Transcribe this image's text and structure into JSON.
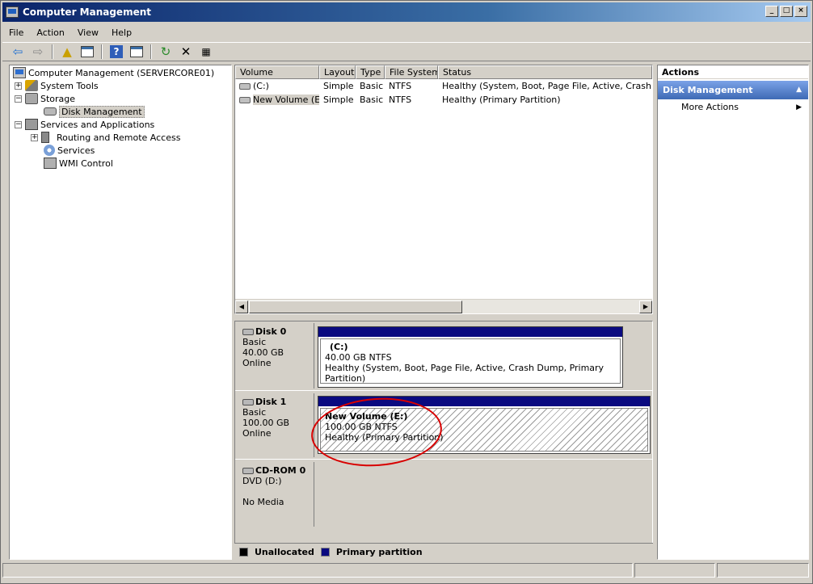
{
  "window": {
    "title": "Computer Management"
  },
  "menu": [
    "File",
    "Action",
    "View",
    "Help"
  ],
  "toolbar": {
    "icons": [
      "back-arrow-icon",
      "forward-arrow-icon",
      "up-folder-icon",
      "show-hide-tree-icon",
      "help-icon",
      "properties-icon",
      "refresh-icon",
      "delete-icon",
      "export-icon"
    ]
  },
  "tree": {
    "root": "Computer Management (SERVERCORE01)",
    "system_tools": "System Tools",
    "storage": "Storage",
    "disk_management": "Disk Management",
    "services_apps": "Services and Applications",
    "routing": "Routing and Remote Access",
    "services": "Services",
    "wmi": "WMI Control"
  },
  "volumes": {
    "columns": [
      "Volume",
      "Layout",
      "Type",
      "File System",
      "Status"
    ],
    "rows": [
      {
        "volume": "(C:)",
        "layout": "Simple",
        "type": "Basic",
        "fs": "NTFS",
        "status": "Healthy (System, Boot, Page File, Active, Crash Dump"
      },
      {
        "volume": "New Volume (E:)",
        "layout": "Simple",
        "type": "Basic",
        "fs": "NTFS",
        "status": "Healthy (Primary Partition)"
      }
    ]
  },
  "disks": [
    {
      "name": "Disk 0",
      "type": "Basic",
      "size": "40.00 GB",
      "state": "Online",
      "partition": {
        "name": "(C:)",
        "size": "40.00 GB NTFS",
        "status": "Healthy (System, Boot, Page File, Active, Crash Dump, Primary Partition)"
      }
    },
    {
      "name": "Disk 1",
      "type": "Basic",
      "size": "100.00 GB",
      "state": "Online",
      "partition": {
        "name": "New Volume  (E:)",
        "size": "100.00 GB NTFS",
        "status": "Healthy (Primary Partition)"
      }
    },
    {
      "name": "CD-ROM 0",
      "type": "DVD (D:)",
      "state": "No Media"
    }
  ],
  "legend": {
    "unallocated": "Unallocated",
    "primary": "Primary partition",
    "colors": {
      "unallocated": "#000000",
      "primary": "#0a0a80"
    }
  },
  "actions": {
    "header": "Actions",
    "group": "Disk Management",
    "more": "More Actions"
  },
  "colors": {
    "annotation": "#d80000",
    "accent": "#0a246a"
  }
}
